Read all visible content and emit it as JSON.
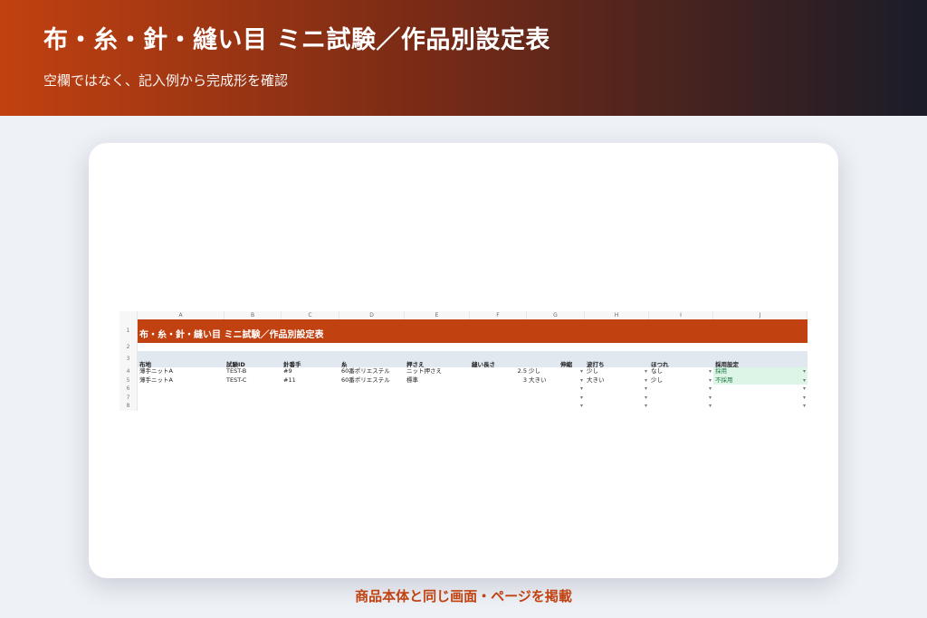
{
  "page": {
    "title": "布・糸・針・縫い目 ミニ試験／作品別設定表",
    "subtitle": "空欄ではなく、記入例から完成形を確認",
    "footer": "商品本体と同じ画面・ページを掲載"
  },
  "sheet": {
    "columns": [
      "A",
      "B",
      "C",
      "D",
      "E",
      "F",
      "G",
      "H",
      "I",
      "J"
    ],
    "row_numbers": [
      "1",
      "2",
      "3",
      "4",
      "5",
      "6",
      "7",
      "8"
    ],
    "title": "布・糸・針・縫い目 ミニ試験／作品別設定表",
    "headers": [
      "布地",
      "試験ID",
      "針番手",
      "糸",
      "押さえ",
      "縫い長さ",
      "伸縮",
      "波打ち",
      "ほつれ",
      "採用設定"
    ],
    "rows": [
      [
        "薄手ニットA",
        "TEST-B",
        "#9",
        "60番ポリエステル",
        "ニット押さえ",
        "",
        "2.5",
        "少し",
        "少し",
        "なし",
        "採用"
      ],
      [
        "薄手ニットA",
        "TEST-C",
        "#11",
        "60番ポリエステル",
        "標準",
        "",
        "3",
        "大きい",
        "大きい",
        "少し",
        "不採用"
      ]
    ]
  },
  "colors": {
    "accent": "#c24110",
    "header_band": "#e1e8f0",
    "adopt_bg": "#dcf5e6"
  },
  "icons": {
    "dropdown": "dropdown-arrow-icon"
  }
}
